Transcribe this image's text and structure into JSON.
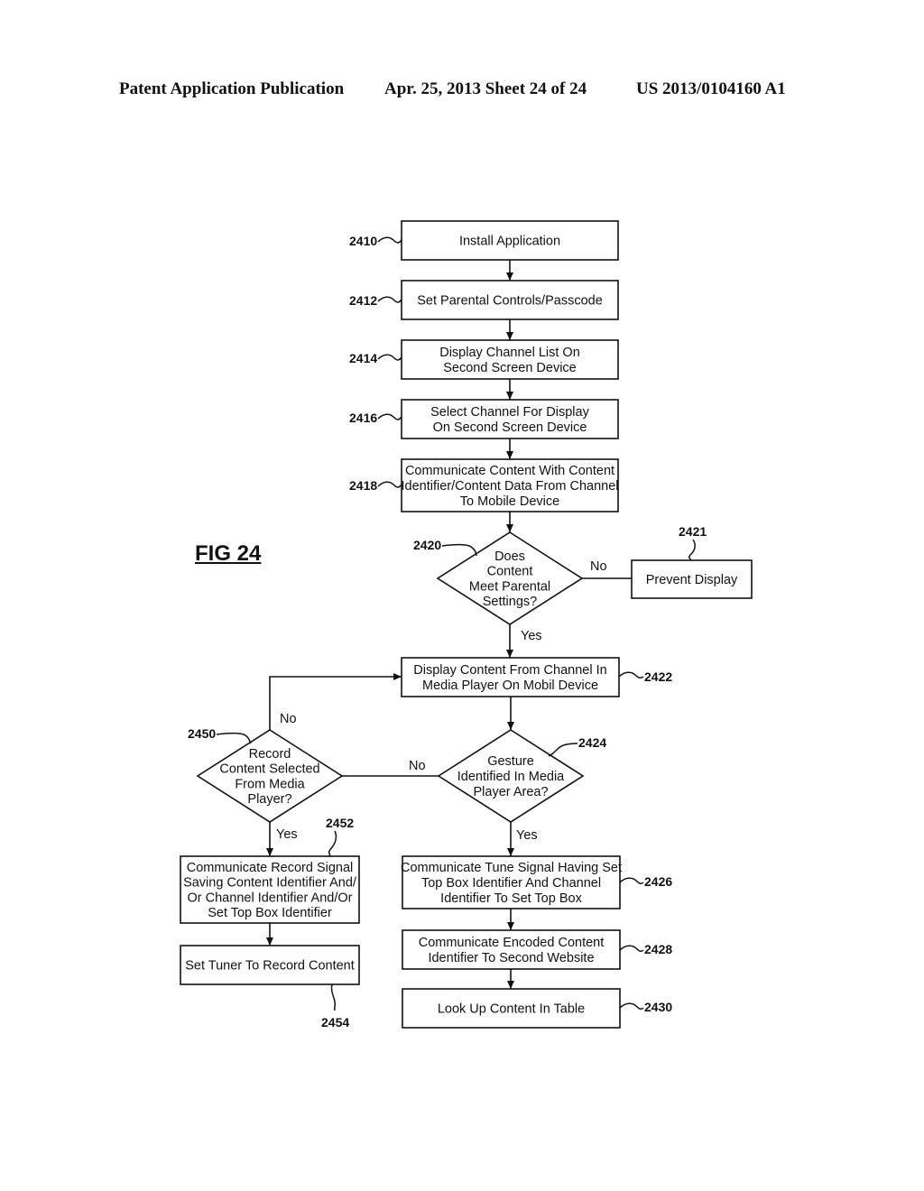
{
  "header": {
    "publication": "Patent Application Publication",
    "date_sheet": "Apr. 25, 2013  Sheet 24 of 24",
    "number": "US 2013/0104160 A1"
  },
  "figure_label": "FIG 24",
  "nodes": [
    {
      "id": "2410",
      "type": "process",
      "lines": [
        "Install Application"
      ]
    },
    {
      "id": "2412",
      "type": "process",
      "lines": [
        "Set Parental Controls/Passcode"
      ]
    },
    {
      "id": "2414",
      "type": "process",
      "lines": [
        "Display Channel List On",
        "Second Screen Device"
      ]
    },
    {
      "id": "2416",
      "type": "process",
      "lines": [
        "Select Channel For Display",
        "On Second Screen Device"
      ]
    },
    {
      "id": "2418",
      "type": "process",
      "lines": [
        "Communicate Content With Content",
        "Identifier/Content Data From Channel",
        "To Mobile Device"
      ]
    },
    {
      "id": "2420",
      "type": "decision",
      "lines": [
        "Does",
        "Content",
        "Meet Parental",
        "Settings?"
      ]
    },
    {
      "id": "2421",
      "type": "process",
      "lines": [
        "Prevent Display"
      ]
    },
    {
      "id": "2422",
      "type": "process",
      "lines": [
        "Display Content From Channel In",
        "Media Player On Mobil Device"
      ]
    },
    {
      "id": "2424",
      "type": "decision",
      "lines": [
        "Gesture",
        "Identified In Media",
        "Player Area?"
      ]
    },
    {
      "id": "2450",
      "type": "decision",
      "lines": [
        "Record",
        "Content Selected",
        "From Media",
        "Player?"
      ]
    },
    {
      "id": "2452",
      "type": "process",
      "lines": [
        "Communicate Record Signal",
        "Saving Content Identifier And/",
        "Or Channel Identifier And/Or",
        "Set Top Box Identifier"
      ]
    },
    {
      "id": "2454",
      "type": "process",
      "lines": [
        "Set Tuner To Record Content"
      ]
    },
    {
      "id": "2426",
      "type": "process",
      "lines": [
        "Communicate Tune Signal Having Set",
        "Top Box Identifier And Channel",
        "Identifier To Set Top Box"
      ]
    },
    {
      "id": "2428",
      "type": "process",
      "lines": [
        "Communicate Encoded Content",
        "Identifier To Second Website"
      ]
    },
    {
      "id": "2430",
      "type": "process",
      "lines": [
        "Look Up Content In Table"
      ]
    }
  ],
  "edges": [
    {
      "from": "2410",
      "to": "2412",
      "label": ""
    },
    {
      "from": "2412",
      "to": "2414",
      "label": ""
    },
    {
      "from": "2414",
      "to": "2416",
      "label": ""
    },
    {
      "from": "2416",
      "to": "2418",
      "label": ""
    },
    {
      "from": "2418",
      "to": "2420",
      "label": ""
    },
    {
      "from": "2420",
      "to": "2421",
      "label": "No"
    },
    {
      "from": "2420",
      "to": "2422",
      "label": "Yes"
    },
    {
      "from": "2422",
      "to": "2424",
      "label": ""
    },
    {
      "from": "2424",
      "to": "2450",
      "label": "No"
    },
    {
      "from": "2424",
      "to": "2426",
      "label": "Yes"
    },
    {
      "from": "2450",
      "to": "2422",
      "label": "No"
    },
    {
      "from": "2450",
      "to": "2452",
      "label": "Yes"
    },
    {
      "from": "2452",
      "to": "2454",
      "label": ""
    },
    {
      "from": "2426",
      "to": "2428",
      "label": ""
    },
    {
      "from": "2428",
      "to": "2430",
      "label": ""
    }
  ]
}
